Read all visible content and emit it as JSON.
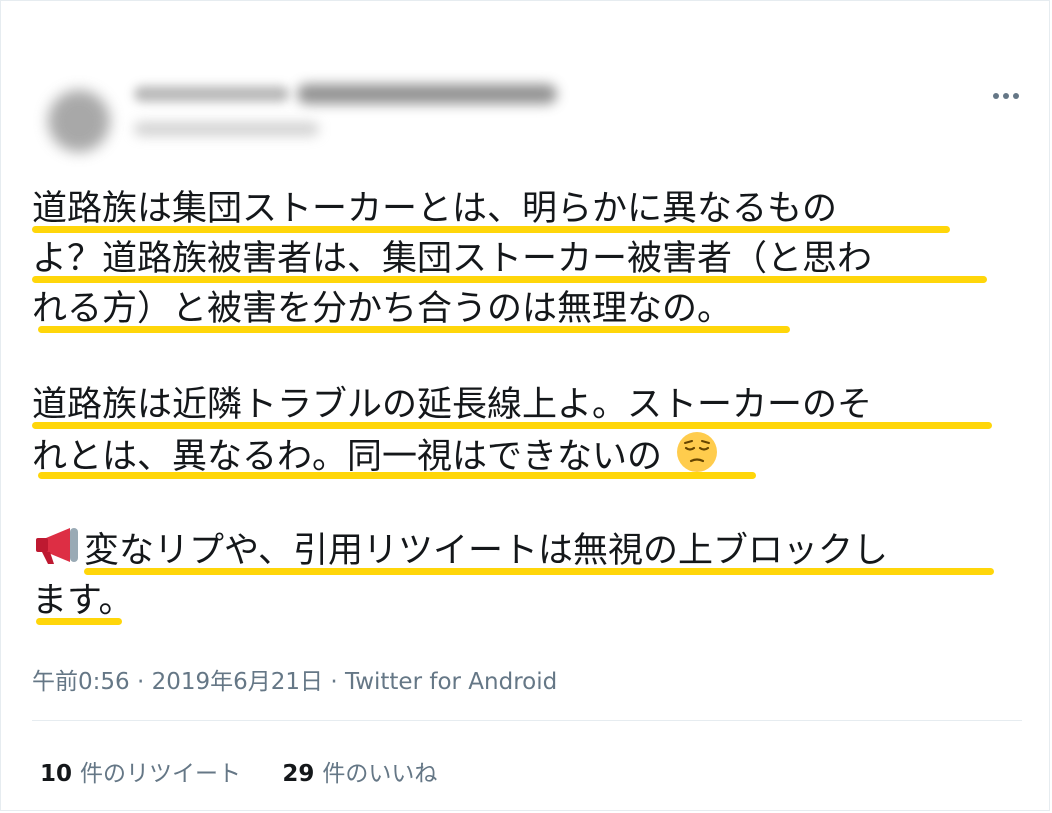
{
  "tweet": {
    "lines": [
      "道路族は集団ストーカーとは、明らかに異なるもの",
      "よ？道路族被害者は、集団ストーカー被害者（と思わ",
      "れる方）と被害を分かち合うのは無理なの。",
      "",
      "道路族は近隣トラブルの延長線上よ。ストーカーのそ",
      "れとは、異なるわ。同一視はできないの",
      "",
      "変なリプや、引用リツイートは無視の上ブロックし",
      "ます。"
    ],
    "highlight_color": "#ffd60a"
  },
  "meta": {
    "timestamp": "午前0:56 · 2019年6月21日 · Twitter for Android"
  },
  "stats": {
    "retweets_count": "10",
    "retweets_label": "件のリツイート",
    "likes_count": "29",
    "likes_label": "件のいいね"
  },
  "icons": {
    "more": "more-dots-icon",
    "face": "pensive-face-emoji-icon",
    "megaphone": "megaphone-emoji-icon"
  }
}
